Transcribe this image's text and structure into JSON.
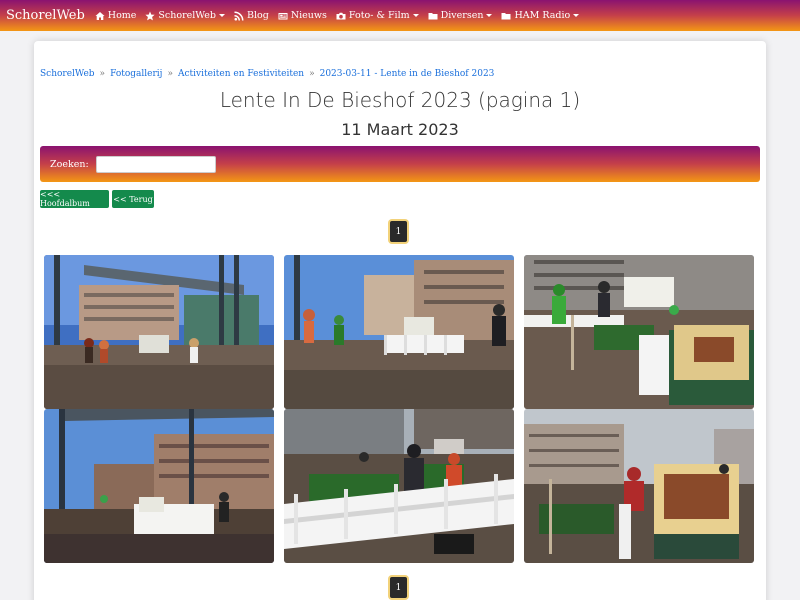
{
  "nav": {
    "brand": "SchorelWeb",
    "items": [
      {
        "label": "Home",
        "icon": "home-icon",
        "dropdown": false
      },
      {
        "label": "SchorelWeb",
        "icon": "star-icon",
        "dropdown": true
      },
      {
        "label": "Blog",
        "icon": "rss-icon",
        "dropdown": false
      },
      {
        "label": "Nieuws",
        "icon": "newspaper-icon",
        "dropdown": false
      },
      {
        "label": "Foto- & Film",
        "icon": "camera-icon",
        "dropdown": true
      },
      {
        "label": "Diversen",
        "icon": "folder-icon",
        "dropdown": true
      },
      {
        "label": "HAM Radio",
        "icon": "folder-icon",
        "dropdown": true
      }
    ]
  },
  "breadcrumb": [
    "SchorelWeb",
    "Fotogallerij",
    "Activiteiten en Festiviteiten",
    "2023-03-11 - Lente in de Bieshof 2023"
  ],
  "page": {
    "title": "Lente In De Bieshof 2023 (pagina 1)",
    "subtitle": "11 Maart 2023"
  },
  "search": {
    "label": "Zoeken:",
    "value": ""
  },
  "buttons": {
    "main_album": "<<< Hoofdalbum",
    "back": "<< Terug"
  },
  "pagination": {
    "current": "1"
  },
  "colors": {
    "gradient_top": "#8a1370",
    "gradient_bottom": "#f49714",
    "button_green": "#148a4c",
    "link": "#1a6fdb"
  }
}
